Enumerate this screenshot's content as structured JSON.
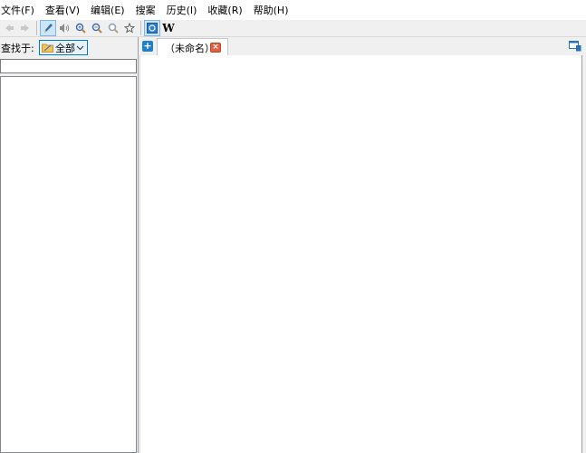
{
  "menu": [
    "文件(F)",
    "查看(V)",
    "编辑(E)",
    "搜案",
    "历史(I)",
    "收藏(R)",
    "帮助(H)"
  ],
  "toolbar": {
    "icons": [
      "back-arrow-icon",
      "forward-arrow-icon",
      "pen-icon",
      "speaker-icon",
      "zoom-in-icon",
      "zoom-out-icon",
      "zoom-reset-icon",
      "star-icon",
      "dictionary-icon",
      "wikipedia-icon"
    ],
    "wiki_label": "W"
  },
  "search": {
    "label": "查找于:",
    "scope": "全部"
  },
  "tabs": [
    {
      "label": "（未命名）",
      "close": "×"
    }
  ],
  "new_tab": "+",
  "colors": {
    "accent": "#0078d7",
    "close": "#e06040",
    "active_button": "#cde6f7"
  }
}
